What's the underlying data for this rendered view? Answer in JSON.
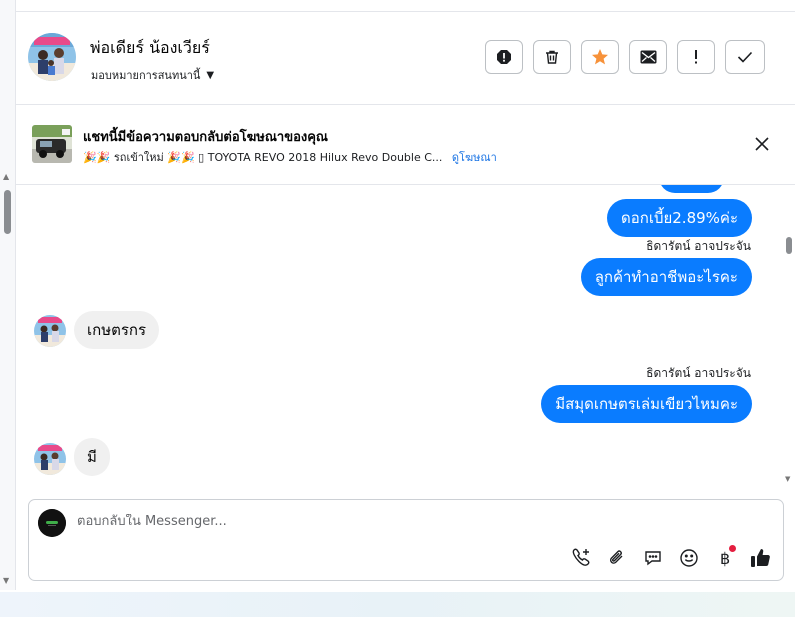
{
  "header": {
    "contact_name": "พ่อเดียร์ น้องเวียร์",
    "assign_label": "มอบหมายการสนทนานี้",
    "actions": [
      {
        "name": "spam-icon",
        "label": "Mark as spam"
      },
      {
        "name": "trash-icon",
        "label": "Delete"
      },
      {
        "name": "star-icon",
        "label": "Star"
      },
      {
        "name": "envelope-icon",
        "label": "Mark as unread"
      },
      {
        "name": "exclamation-icon",
        "label": "Follow up"
      },
      {
        "name": "check-icon",
        "label": "Done"
      }
    ],
    "star_color": "#f7923a"
  },
  "ad_banner": {
    "title": "แชทนี้มีข้อความตอบกลับต่อโฆษณาของคุณ",
    "subtitle": "🎉🎉 รถเข้าใหม่ 🎉🎉 ▯ TOYOTA REVO 2018 Hilux Revo Double C...",
    "link": "ดูโฆษณา"
  },
  "messages": [
    {
      "direction": "out",
      "text": "ดอกเบี้ย2.89%ค่ะ"
    },
    {
      "direction": "out",
      "sender": "ธิดารัตน์ อาจประจัน",
      "text": "ลูกค้าทำอาชีพอะไรคะ"
    },
    {
      "direction": "in",
      "text": "เกษตรกร"
    },
    {
      "direction": "out",
      "sender": "ธิดารัตน์ อาจประจัน",
      "text": "มีสมุดเกษตรเล่มเขียวไหมคะ"
    },
    {
      "direction": "in",
      "text": "มี"
    }
  ],
  "composer": {
    "placeholder": "ตอบกลับใน Messenger...",
    "value": "",
    "tools": [
      "phone-add-icon",
      "paperclip-icon",
      "saved-reply-icon",
      "emoji-icon",
      "baht-payment-icon",
      "thumbs-up-icon"
    ]
  },
  "colors": {
    "outgoing_bubble": "#0a7cff",
    "incoming_bubble": "#f0f0f0",
    "link": "#1b74e4",
    "notification_dot": "#e41e3f"
  }
}
